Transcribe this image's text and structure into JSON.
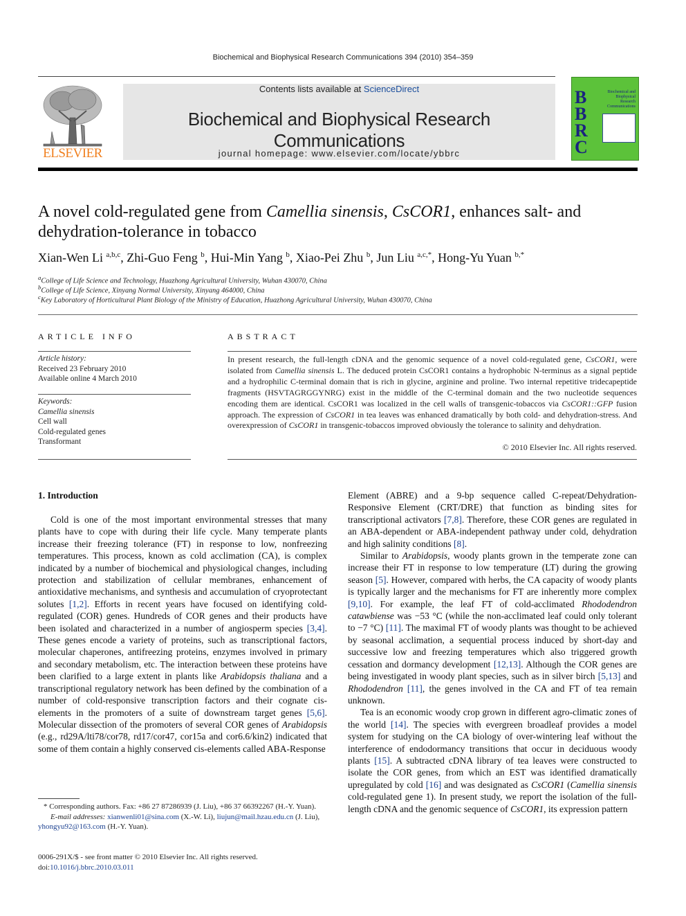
{
  "header": {
    "running_head": "Biochemical and Biophysical Research Communications 394 (2010) 354–359",
    "contents_prefix": "Contents lists available at ",
    "contents_link": "ScienceDirect",
    "journal_title": "Biochemical and Biophysical Research Communications",
    "homepage": "journal homepage: www.elsevier.com/locate/ybbrc",
    "publisher_logo_text": "ELSEVIER",
    "cover": {
      "letters": [
        "B",
        "B",
        "R",
        "C"
      ],
      "caption": "Biochemical and Biophysical Research Communications",
      "color": "#5cc23a"
    },
    "colors": {
      "link": "#1a3f8f",
      "elsevier_orange": "#f07f1e",
      "banner_bg": "#e6e6e6"
    }
  },
  "article": {
    "title_parts": {
      "t1": "A novel cold-regulated gene from ",
      "t2": "Camellia sinensis",
      "t3": ", ",
      "t4": "CsCOR1",
      "t5": ", enhances salt- and dehydration-tolerance in tobacco"
    },
    "authors": [
      {
        "name": "Xian-Wen Li",
        "sup": "a,b,c"
      },
      {
        "name": "Zhi-Guo Feng",
        "sup": "b"
      },
      {
        "name": "Hui-Min Yang",
        "sup": "b"
      },
      {
        "name": "Xiao-Pei Zhu",
        "sup": "b"
      },
      {
        "name": "Jun Liu",
        "sup": "a,c,*"
      },
      {
        "name": "Hong-Yu Yuan",
        "sup": "b,*"
      }
    ],
    "affiliations": [
      {
        "mark": "a",
        "text": "College of Life Science and Technology, Huazhong Agricultural University, Wuhan 430070, China"
      },
      {
        "mark": "b",
        "text": "College of Life Science, Xinyang Normal University, Xinyang 464000, China"
      },
      {
        "mark": "c",
        "text": "Key Laboratory of Horticultural Plant Biology of the Ministry of Education, Huazhong Agricultural University, Wuhan 430070, China"
      }
    ]
  },
  "article_info": {
    "heading": "ARTICLE INFO",
    "history_label": "Article history:",
    "received": "Received 23 February 2010",
    "online": "Available online 4 March 2010",
    "keywords_label": "Keywords:",
    "keywords": [
      "Camellia sinensis",
      "Cell wall",
      "Cold-regulated genes",
      "Transformant"
    ]
  },
  "abstract": {
    "heading": "ABSTRACT",
    "p1": "In present research, the full-length cDNA and the genomic sequence of a novel cold-regulated gene, ",
    "g1": "CsCOR1",
    "p2": ", were isolated from ",
    "g2": "Camellia sinensis",
    "p3": " L. The deduced protein CsCOR1 contains a hydrophobic N-terminus as a signal peptide and a hydrophilic C-terminal domain that is rich in glycine, arginine and proline. Two internal repetitive tridecapeptide fragments (HSVTAGRGGYNRG) exist in the middle of the C-terminal domain and the two nucleotide sequences encoding them are identical. CsCOR1 was localized in the cell walls of transgenic-tobaccos via ",
    "g3": "CsCOR1::GFP",
    "p4": " fusion approach. The expression of ",
    "g4": "CsCOR1",
    "p5": " in tea leaves was enhanced dramatically by both cold- and dehydration-stress. And overexpression of ",
    "g5": "CsCOR1",
    "p6": " in transgenic-tobaccos improved obviously the tolerance to salinity and dehydration.",
    "copyright": "© 2010 Elsevier Inc. All rights reserved."
  },
  "intro": {
    "heading": "1.  Introduction",
    "left": {
      "a1": "Cold is one of the most important environmental stresses that many plants have to cope with during their life cycle. Many temperate plants increase their freezing tolerance (FT) in response to low, nonfreezing temperatures. This process, known as cold acclimation (CA), is complex indicated by a number of biochemical and physiological changes, including protection and stabilization of cellular membranes, enhancement of antioxidative mechanisms, and synthesis and accumulation of cryoprotectant solutes ",
      "r1": "[1,2]",
      "a2": ". Efforts in recent years have focused on identifying cold-regulated (COR) genes. Hundreds of COR genes and their products have been isolated and characterized in a number of angiosperm species ",
      "r2": "[3,4]",
      "a3": ". These genes encode a variety of proteins, such as transcriptional factors, molecular chaperones, antifreezing proteins, enzymes involved in primary and secondary metabolism, etc. The interaction between these proteins have been clarified to a large extent in plants like ",
      "i1": "Arabidopsis thaliana",
      "a4": " and a transcriptional regulatory network has been defined by the combination of a number of cold-responsive transcription factors and their cognate cis-elements in the promoters of a suite of downstream target genes ",
      "r3": "[5,6]",
      "a5": ". Molecular dissection of the promoters of several COR genes of ",
      "i2": "Arabidopsis",
      "a6": " (e.g., rd29A/lti78/cor78, rd17/cor47, cor15a and cor6.6/kin2) indicated that some of them contain a highly conserved cis-elements called ABA-Response"
    },
    "right": {
      "b1": "Element (ABRE) and a 9-bp sequence called C-repeat/Dehydration-Responsive Element (CRT/DRE) that function as binding sites for transcriptional activators ",
      "r4": "[7,8]",
      "b2": ". Therefore, these COR genes are regulated in an ABA-dependent or ABA-independent pathway under cold, dehydration and high salinity conditions ",
      "r5": "[8]",
      "b3": ".",
      "c1": "Similar to ",
      "i3": "Arabidopsis",
      "c2": ", woody plants grown in the temperate zone can increase their FT in response to low temperature (LT) during the growing season ",
      "r6": "[5]",
      "c3": ". However, compared with herbs, the CA capacity of woody plants is typically larger and the mechanisms for FT are inherently more complex ",
      "r7": "[9,10]",
      "c4": ". For example, the leaf FT of cold-acclimated ",
      "i4": "Rhododendron catawbiense",
      "c5": " was −53 °C (while the non-acclimated leaf could only tolerant to −7 °C) ",
      "r8": "[11]",
      "c6": ". The maximal FT of woody plants was thought to be achieved by seasonal acclimation, a sequential process induced by short-day and successive low and freezing temperatures which also triggered growth cessation and dormancy development ",
      "r9": "[12,13]",
      "c7": ". Although the COR genes are being investigated in woody plant species, such as in silver birch ",
      "r10": "[5,13]",
      "c8": " and ",
      "i5": "Rhododendron",
      "c9": " ",
      "r11": "[11]",
      "c10": ", the genes involved in the CA and FT of tea remain unknown.",
      "d1": "Tea is an economic woody crop grown in different agro-climatic zones of the world ",
      "r12": "[14]",
      "d2": ". The species with evergreen broadleaf provides a model system for studying on the CA biology of over-wintering leaf without the interference of endodormancy transitions that occur in deciduous woody plants ",
      "r13": "[15]",
      "d3": ". A subtracted cDNA library of tea leaves were constructed to isolate the COR genes, from which an EST was identified dramatically upregulated by cold ",
      "r14": "[16]",
      "d4": " and was designated as ",
      "i6": "CsCOR1",
      "d5": " (",
      "i7": "Camellia sinensis",
      "d6": " cold-regulated gene 1). In present study, we report the isolation of the full-length cDNA and the genomic sequence of ",
      "i8": "CsCOR1",
      "d7": ", its expression pattern"
    }
  },
  "footnotes": {
    "corresponding": "* Corresponding authors. Fax: +86 27 87286939 (J. Liu), +86 37 66392267 (H.-Y. Yuan).",
    "email_label": "E-mail addresses: ",
    "email1": "xianwenli01@sina.com",
    "email1_who": " (X.-W. Li), ",
    "email2": "liujun@mail.hzau.edu.cn",
    "email2_who": " (J. Liu), ",
    "email3": "yhongyu92@163.com",
    "email3_who": " (H.-Y. Yuan).",
    "front_matter": "0006-291X/$ - see front matter © 2010 Elsevier Inc. All rights reserved.",
    "doi_prefix": "doi:",
    "doi": "10.1016/j.bbrc.2010.03.011"
  }
}
